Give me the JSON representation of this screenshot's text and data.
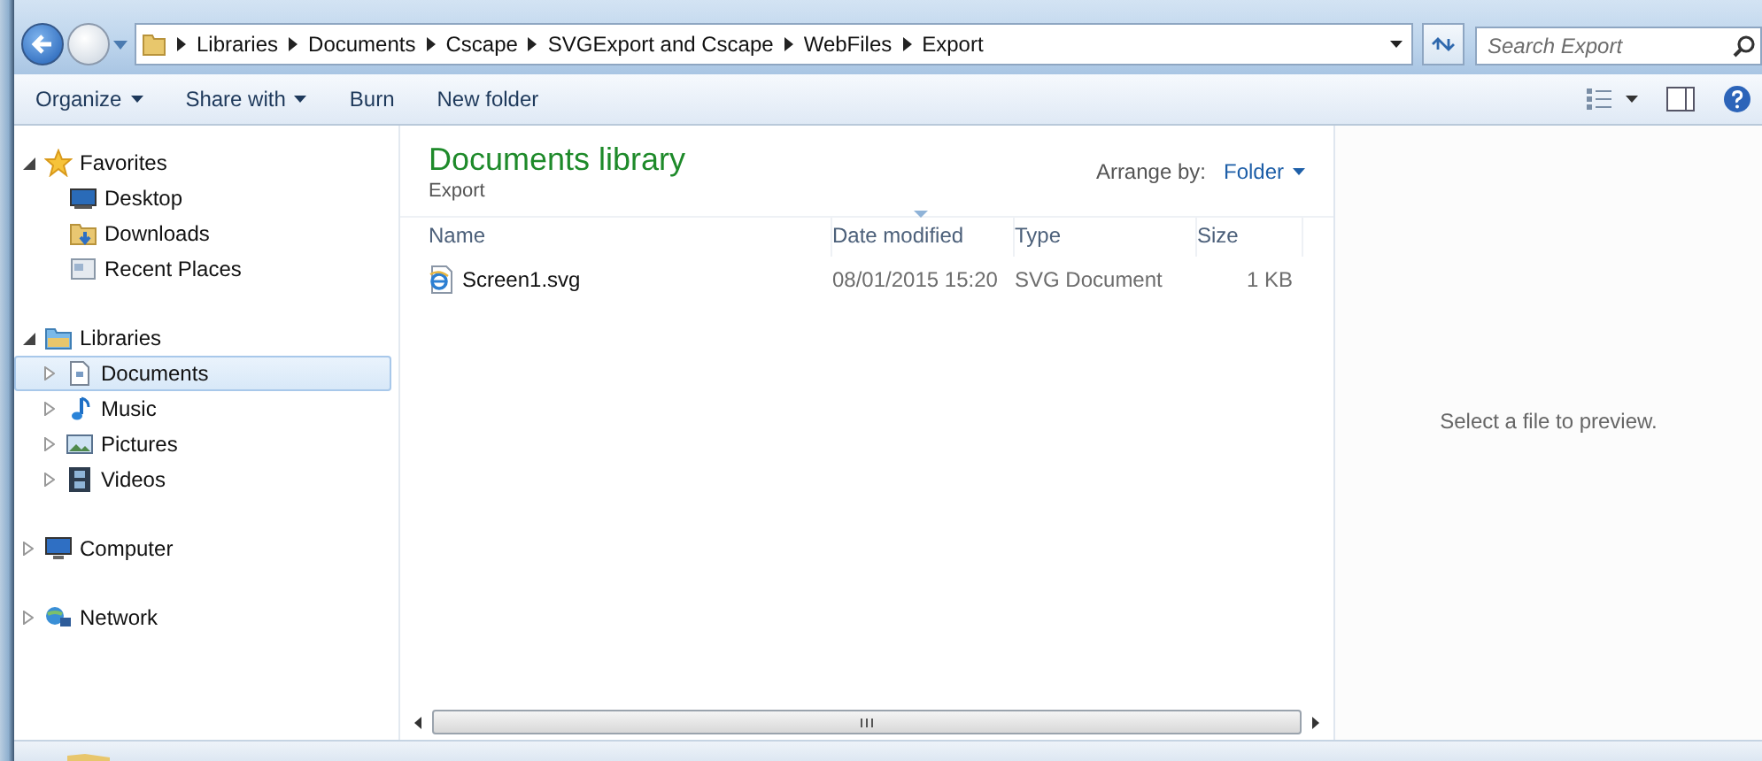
{
  "address_bar": {
    "path": [
      "Libraries",
      "Documents",
      "Cscape",
      "SVGExport and Cscape",
      "WebFiles",
      "Export"
    ]
  },
  "search": {
    "placeholder": "Search Export"
  },
  "toolbar": {
    "buttons": [
      {
        "label": "Organize",
        "dropdown": true
      },
      {
        "label": "Share with",
        "dropdown": true
      },
      {
        "label": "Burn",
        "dropdown": false
      },
      {
        "label": "New folder",
        "dropdown": false
      }
    ]
  },
  "navigation": {
    "groups": [
      {
        "label": "Favorites",
        "kind": "star",
        "expanded": true,
        "selected": false,
        "children": [
          {
            "label": "Desktop",
            "kind": "desktop",
            "selected": false
          },
          {
            "label": "Downloads",
            "kind": "downloads",
            "selected": false
          },
          {
            "label": "Recent Places",
            "kind": "recent",
            "selected": false
          }
        ]
      },
      {
        "label": "Libraries",
        "kind": "library",
        "expanded": true,
        "selected": false,
        "children": [
          {
            "label": "Documents",
            "kind": "document",
            "expanded": false,
            "selected": true
          },
          {
            "label": "Music",
            "kind": "music",
            "expanded": false,
            "selected": false
          },
          {
            "label": "Pictures",
            "kind": "pictures",
            "expanded": false,
            "selected": false
          },
          {
            "label": "Videos",
            "kind": "videos",
            "expanded": false,
            "selected": false
          }
        ]
      },
      {
        "label": "Computer",
        "kind": "computer",
        "expanded": false,
        "selected": false
      },
      {
        "label": "Network",
        "kind": "network",
        "expanded": false,
        "selected": false
      }
    ]
  },
  "library": {
    "title": "Documents library",
    "subtitle": "Export",
    "arrange_label": "Arrange by:",
    "arrange_value": "Folder"
  },
  "table": {
    "columns": [
      {
        "label": "Name",
        "sorted": false
      },
      {
        "label": "Date modified",
        "sorted": true
      },
      {
        "label": "Type",
        "sorted": false
      },
      {
        "label": "Size",
        "sorted": false
      }
    ],
    "rows": [
      {
        "name": "Screen1.svg",
        "date_modified": "08/01/2015 15:20",
        "type": "SVG Document",
        "size": "1 KB",
        "selected": false
      }
    ]
  },
  "preview": {
    "message": "Select a file to preview."
  }
}
